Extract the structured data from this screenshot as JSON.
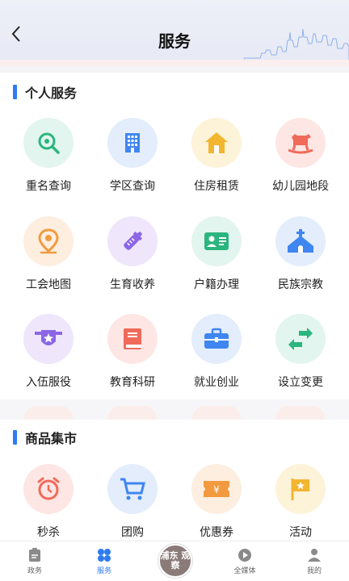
{
  "header": {
    "title": "服务"
  },
  "personal": {
    "title": "个人服务",
    "items": [
      {
        "label": "重名查询",
        "icon": "search-icon",
        "bg": "#e2f5ee",
        "fg": "#2bb57f"
      },
      {
        "label": "学区查询",
        "icon": "building-icon",
        "bg": "#e3edfc",
        "fg": "#3f86f0"
      },
      {
        "label": "住房租赁",
        "icon": "house-icon",
        "bg": "#fdf3d9",
        "fg": "#f2b631"
      },
      {
        "label": "幼儿园地段",
        "icon": "rocking-horse-icon",
        "bg": "#fde6e3",
        "fg": "#f06a5a"
      },
      {
        "label": "工会地图",
        "icon": "map-pin-icon",
        "bg": "#fdeee0",
        "fg": "#f29a3f"
      },
      {
        "label": "生育收养",
        "icon": "baby-bottle-icon",
        "bg": "#efe6fb",
        "fg": "#8b66e5"
      },
      {
        "label": "户籍办理",
        "icon": "id-card-icon",
        "bg": "#e2f5ee",
        "fg": "#2bb57f"
      },
      {
        "label": "民族宗教",
        "icon": "church-icon",
        "bg": "#e3edfc",
        "fg": "#3f86f0"
      },
      {
        "label": "入伍服役",
        "icon": "military-badge-icon",
        "bg": "#efe6fb",
        "fg": "#8b66e5"
      },
      {
        "label": "教育科研",
        "icon": "book-icon",
        "bg": "#fde6e3",
        "fg": "#f06a5a"
      },
      {
        "label": "就业创业",
        "icon": "briefcase-icon",
        "bg": "#e3edfc",
        "fg": "#3f86f0"
      },
      {
        "label": "设立变更",
        "icon": "swap-arrows-icon",
        "bg": "#e2f5ee",
        "fg": "#2bb57f"
      }
    ]
  },
  "market": {
    "title": "商品集市",
    "items": [
      {
        "label": "秒杀",
        "icon": "alarm-clock-icon",
        "bg": "#fde6e3",
        "fg": "#f06a5a"
      },
      {
        "label": "团购",
        "icon": "cart-icon",
        "bg": "#e3edfc",
        "fg": "#3f86f0"
      },
      {
        "label": "优惠券",
        "icon": "coupon-icon",
        "bg": "#fdeee0",
        "fg": "#f29a3f"
      },
      {
        "label": "活动",
        "icon": "flag-icon",
        "bg": "#fdf3d9",
        "fg": "#f2b631"
      }
    ]
  },
  "tabbar": {
    "items": [
      {
        "label": "政务",
        "icon": "clipboard-icon"
      },
      {
        "label": "服务",
        "icon": "grid-icon"
      },
      {
        "label": "全媒体",
        "icon": "play-icon"
      },
      {
        "label": "我的",
        "icon": "user-icon"
      }
    ],
    "logo_text": "浦东 观察"
  },
  "colors": {
    "accent": "#2f7bf0"
  }
}
